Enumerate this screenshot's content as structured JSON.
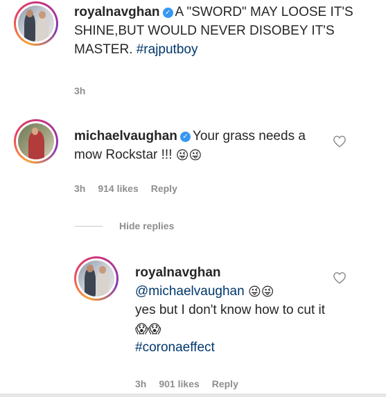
{
  "post": {
    "username": "royalnavghan",
    "caption": "A \"SWORD\" MAY LOOSE IT'S SHINE,BUT WOULD NEVER DISOBEY IT'S MASTER.",
    "hashtag": "#rajputboy",
    "time": "3h"
  },
  "comment": {
    "username": "michaelvaughan",
    "text": "Your grass needs a mow Rockstar !!!",
    "emoji": "😜😜",
    "time": "3h",
    "likes": "914 likes",
    "reply_label": "Reply",
    "hide_replies_label": "Hide replies"
  },
  "reply": {
    "username": "royalnavghan",
    "mention": "@michaelvaughan",
    "emoji_after_mention": "😜😜",
    "text": "yes but I don't know how to cut it",
    "emoji_after_text": "😱😱",
    "hashtag": "#coronaeffect",
    "time": "3h",
    "likes": "901 likes",
    "reply_label": "Reply"
  },
  "icons": {
    "verified": "verified-badge-icon",
    "like": "heart-outline-icon"
  },
  "colors": {
    "link": "#00376b",
    "verified": "#3897f0",
    "meta": "#8e8e8e"
  }
}
